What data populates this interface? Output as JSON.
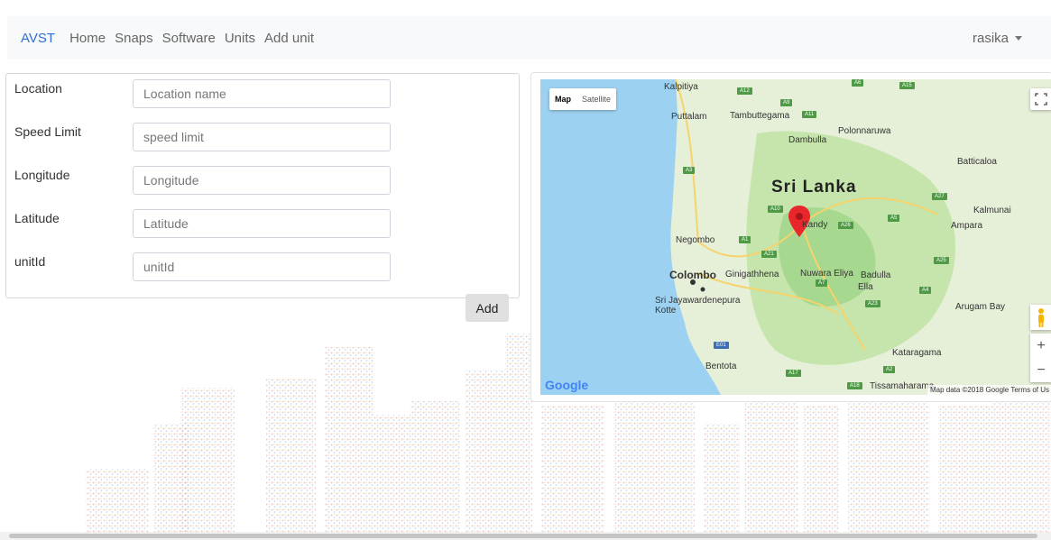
{
  "nav": {
    "brand": "AVST",
    "links": [
      "Home",
      "Snaps",
      "Software",
      "Units",
      "Add unit"
    ],
    "user": "rasika"
  },
  "form": {
    "fields": [
      {
        "label": "Location",
        "placeholder": "Location name"
      },
      {
        "label": "Speed Limit",
        "placeholder": "speed limit"
      },
      {
        "label": "Longitude",
        "placeholder": "Longitude"
      },
      {
        "label": "Latitude",
        "placeholder": "Latitude"
      },
      {
        "label": "unitId",
        "placeholder": "unitId"
      }
    ],
    "add_label": "Add"
  },
  "map": {
    "type_map": "Map",
    "type_satellite": "Satellite",
    "country": "Sri Lanka",
    "places": [
      "Kalpitiya",
      "Puttalam",
      "Tambuttegama",
      "Polonnaruwa",
      "Dambulla",
      "Batticaloa",
      "Kalmunai",
      "Ampara",
      "Kandy",
      "Negombo",
      "Colombo",
      "Ginigathhena",
      "Nuwara Eliya",
      "Badulla",
      "Ella",
      "Sri Jayawardenepura Kotte",
      "Arugam Bay",
      "Kataragama",
      "Bentota",
      "Tissamaharama"
    ],
    "roads": [
      "A12",
      "A9",
      "A11",
      "A15",
      "A6",
      "A3",
      "A27",
      "A10",
      "A26",
      "A5",
      "A1",
      "A21",
      "A7",
      "A25",
      "A4",
      "A23",
      "A2",
      "A17",
      "A18",
      "E01"
    ],
    "logo": "Google",
    "attribution": "Map data ©2018 Google   Terms of Us",
    "zoom_in": "+",
    "zoom_out": "−",
    "colors": {
      "water": "#9dd1f2",
      "land": "#e6efd8",
      "green": "#bfe3a5",
      "marker": "#e8262b"
    }
  }
}
